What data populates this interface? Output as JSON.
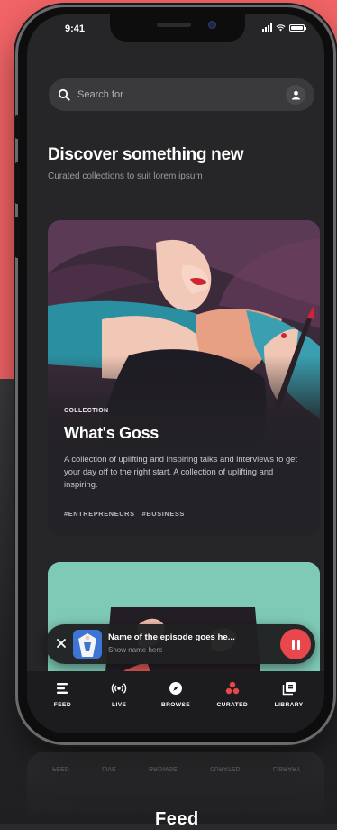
{
  "status_bar": {
    "time": "9:41"
  },
  "search": {
    "placeholder": "Search for"
  },
  "header": {
    "title": "Discover something new",
    "subtitle": "Curated collections to suit lorem ipsum"
  },
  "collection_card": {
    "eyebrow": "COLLECTION",
    "title": "What's Goss",
    "description": "A collection of uplifting and inspiring talks and interviews to get your day off to the right start. A collection of uplifting and inspiring.",
    "tags": [
      "#ENTREPRENEURS",
      "#BUSINESS"
    ]
  },
  "mini_player": {
    "episode_title": "Name of the episode goes he...",
    "show_name": "Show name here"
  },
  "tabs": [
    {
      "label": "FEED",
      "icon": "feed-icon"
    },
    {
      "label": "LIVE",
      "icon": "live-icon"
    },
    {
      "label": "BROWSE",
      "icon": "browse-icon"
    },
    {
      "label": "CURATED",
      "icon": "curated-icon",
      "active": true
    },
    {
      "label": "LIBRARY",
      "icon": "library-icon"
    }
  ],
  "caption": "Feed",
  "colors": {
    "background_top": "#f26466",
    "accent": "#e8484c",
    "screen": "#262628"
  }
}
